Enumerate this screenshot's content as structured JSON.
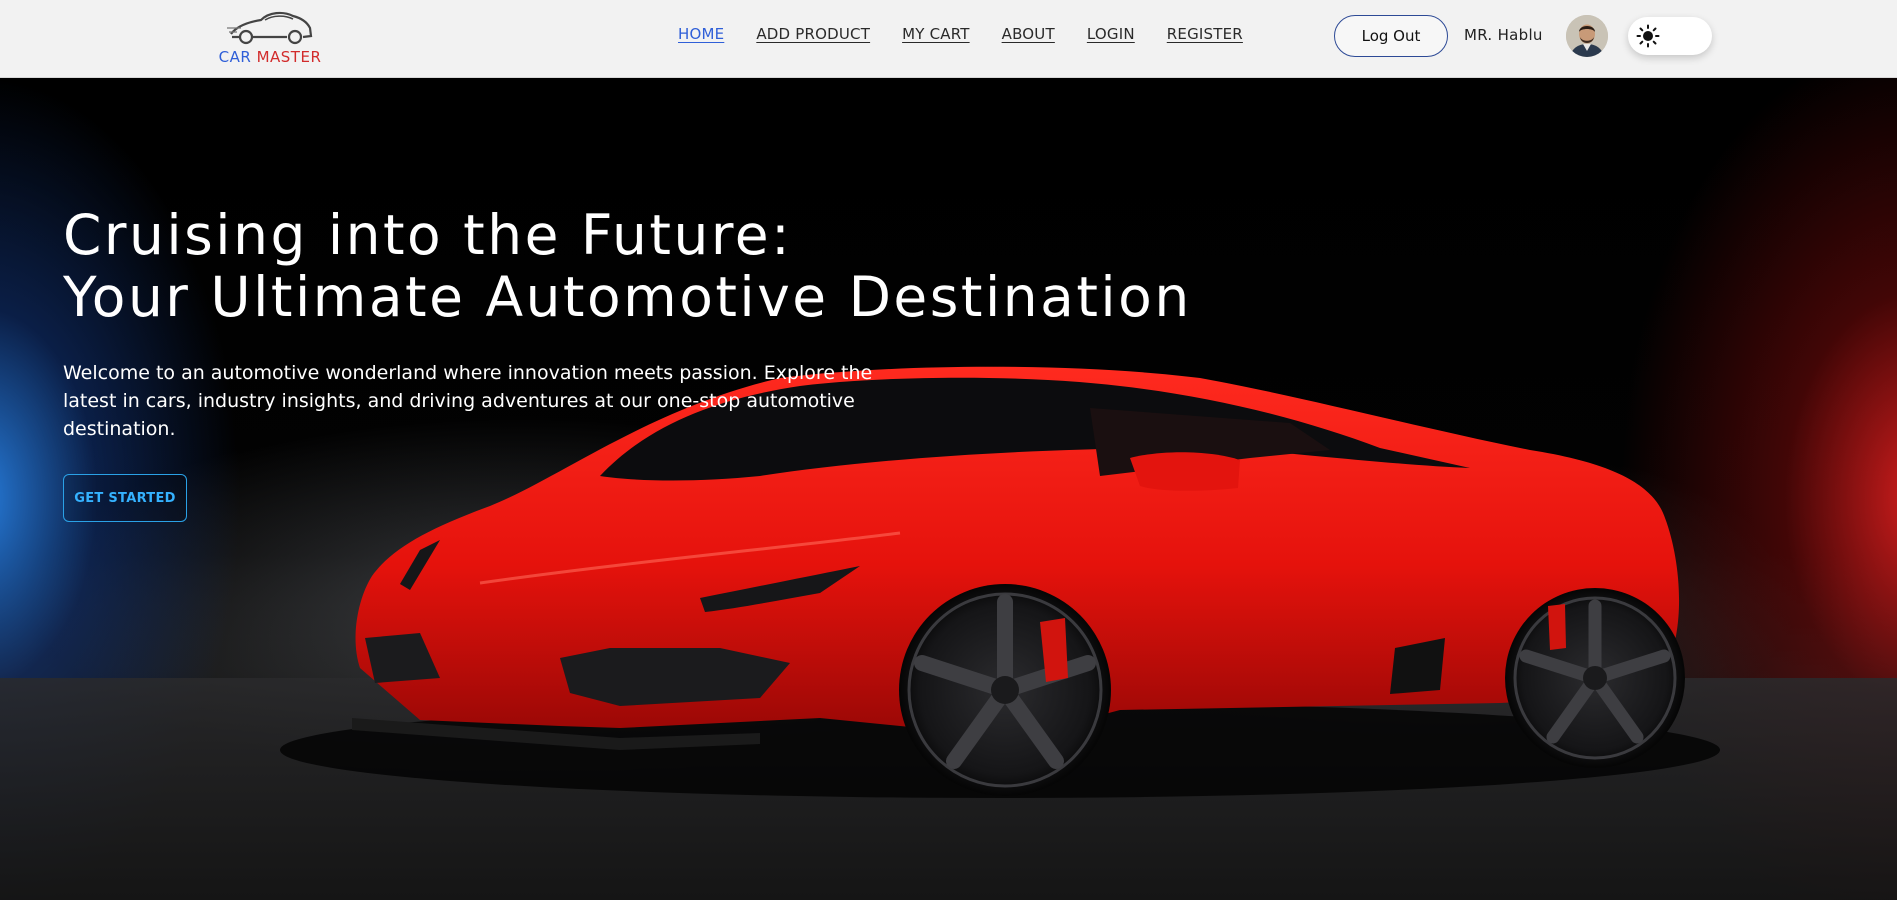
{
  "brand": {
    "name_part1": "CAR",
    "name_part2": "MASTER",
    "color_part1": "#2f5fd8",
    "color_part2": "#d22b2b",
    "logo_icon": "car-silhouette-icon"
  },
  "nav": {
    "links": [
      {
        "label": "HOME",
        "active": true
      },
      {
        "label": "ADD PRODUCT",
        "active": false
      },
      {
        "label": "MY CART",
        "active": false
      },
      {
        "label": "ABOUT",
        "active": false
      },
      {
        "label": "LOGIN",
        "active": false
      },
      {
        "label": "REGISTER",
        "active": false
      }
    ],
    "active_color": "#2f5fd8"
  },
  "user": {
    "logout_label": "Log Out",
    "name": "MR. Hablu",
    "avatar_icon": "user-avatar-photo"
  },
  "theme_toggle": {
    "icon": "sun-icon",
    "mode": "light"
  },
  "hero": {
    "title_line1": "Cruising into the Future:",
    "title_line2": "Your Ultimate Automotive Destination",
    "description": "Welcome to an automotive wonderland where innovation meets passion. Explore the latest in cars, industry insights, and driving adventures at our one-stop automotive destination.",
    "cta_label": "GET STARTED",
    "cta_color": "#35b2ff",
    "image_icon": "red-sports-car-image",
    "smoke_left_color": "#2882e6",
    "smoke_right_color": "#dc1e1e"
  }
}
